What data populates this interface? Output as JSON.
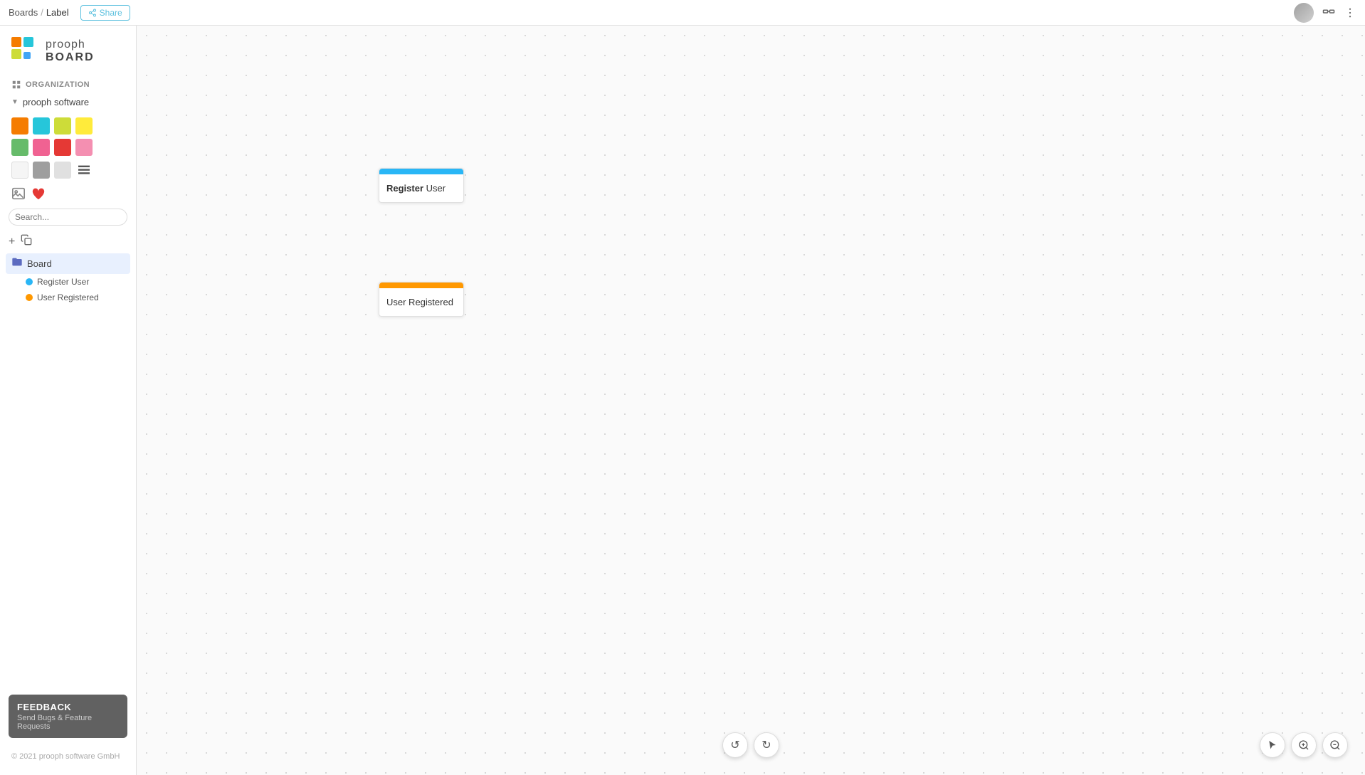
{
  "header": {
    "breadcrumb_boards": "Boards",
    "breadcrumb_sep": "/",
    "breadcrumb_current": "Label",
    "share_button": "Share",
    "share_icon": "share-icon"
  },
  "sidebar": {
    "logo_prooph": "prooph",
    "logo_board": "BOARD",
    "org_label": "ORGANIZATION",
    "org_name": "prooph software",
    "search_placeholder": "Search...",
    "add_button": "+",
    "tree": {
      "board_label": "Board",
      "item1_label": "Register User",
      "item2_label": "User Registered"
    },
    "feedback": {
      "title": "FEEDBACK",
      "subtitle": "Send Bugs & Feature Requests"
    },
    "copyright": "© 2021 prooph software GmbH"
  },
  "canvas": {
    "card1": {
      "text_bold": "Register",
      "text_normal": " User",
      "bar_color": "#29b6f6"
    },
    "card2": {
      "text": "User Registered",
      "bar_color": "#ff9800"
    }
  },
  "colors": {
    "swatches": [
      "#f57c00",
      "#26c6da",
      "#cddc39",
      "#ffeb3b",
      "#66bb6a",
      "#f06292",
      "#e53935",
      "#f48fb1",
      "#f5f5f5",
      "#9e9e9e",
      "#e0e0e0"
    ]
  },
  "toolbar": {
    "undo": "↺",
    "redo": "↻",
    "cursor": "↖",
    "zoom_in": "+",
    "zoom_out": "−"
  }
}
